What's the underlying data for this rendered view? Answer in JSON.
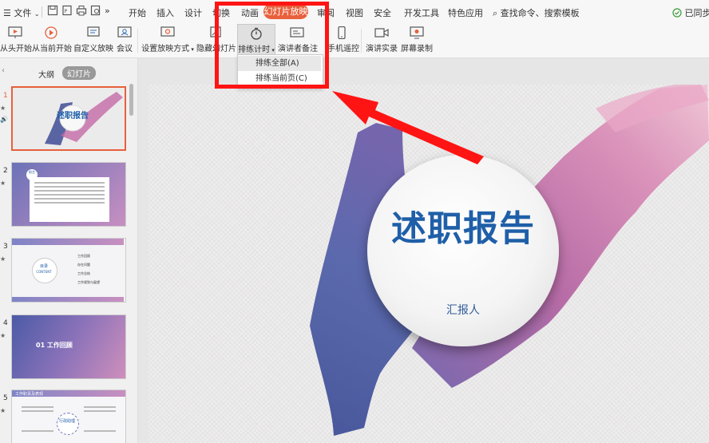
{
  "menubar": {
    "file": "文件",
    "tabs": [
      "开始",
      "插入",
      "设计",
      "切换",
      "动画",
      "幻灯片放映",
      "审阅",
      "视图",
      "安全",
      "开发工具",
      "特色应用"
    ],
    "active_tab": "幻灯片放映",
    "search": "查找命令、搜索模板",
    "sync": "已同步"
  },
  "ribbon": {
    "buttons": [
      "从头开始",
      "从当前开始",
      "自定义放映",
      "会议",
      "设置放映方式",
      "隐藏幻灯片",
      "排练计时",
      "演讲者备注",
      "手机遥控",
      "演讲实录",
      "屏幕录制"
    ]
  },
  "dropdown": {
    "items": [
      "排练全部(A)",
      "排练当前页(C)"
    ]
  },
  "panel": {
    "tabs": [
      "大纲",
      "幻灯片"
    ],
    "slide_numbers": [
      "1",
      "2",
      "3",
      "4",
      "5"
    ]
  },
  "thumbs": {
    "s1": "述职报告",
    "s2": "前言",
    "s3_head": "目录",
    "s3_sub": "CONTENT",
    "s3_items": [
      "工作回顾",
      "存在问题",
      "工作总结",
      "工作规划与展望"
    ],
    "s4": "01 工作回顾",
    "s5_title": "工作职责及表现",
    "s5_badge": "行政助理"
  },
  "slide": {
    "title": "述职报告",
    "subtitle": "汇报人"
  },
  "colors": {
    "accent": "#e8603c",
    "highlight_box": "#ff1414",
    "title_blue": "#1f5fa8"
  }
}
